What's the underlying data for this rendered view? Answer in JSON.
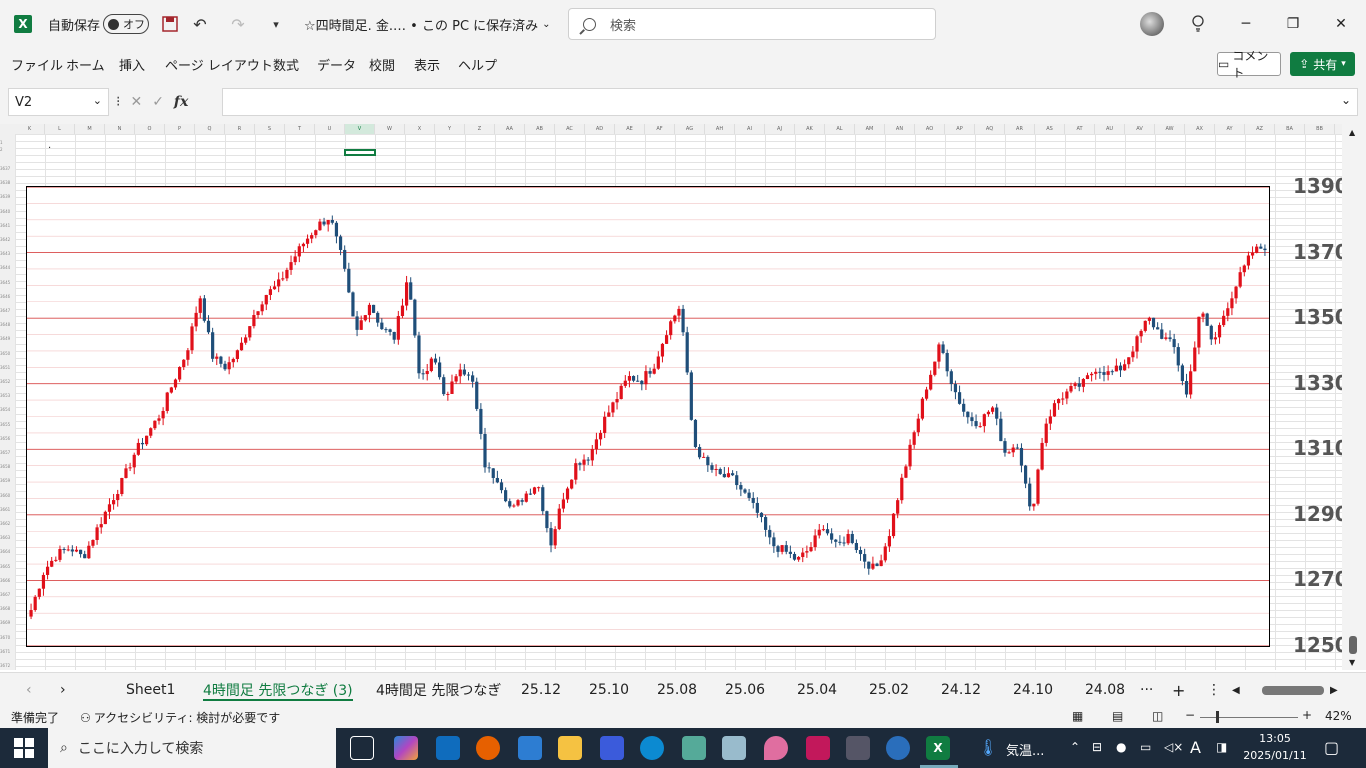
{
  "titlebar": {
    "autosave_label": "自動保存",
    "autosave_state": "オフ",
    "doc_title": "☆四時間足. 金.… • この PC に保存済み",
    "search_placeholder": "検索",
    "minimize": "─",
    "restore": "❐",
    "close": "✕"
  },
  "ribbon": {
    "tabs": [
      "ファイル",
      "ホーム",
      "挿入",
      "ページ レイアウト",
      "数式",
      "データ",
      "校閲",
      "表示",
      "ヘルプ"
    ],
    "comment_label": "コメント",
    "share_label": "共有"
  },
  "formula_bar": {
    "name_box": "V2",
    "fx": "fx",
    "formula": ""
  },
  "grid": {
    "columns": [
      "K",
      "L",
      "M",
      "N",
      "O",
      "P",
      "Q",
      "R",
      "S",
      "T",
      "U",
      "V",
      "W",
      "X",
      "Y",
      "Z",
      "AA",
      "AB",
      "AC",
      "AD",
      "AE",
      "AF",
      "AG",
      "AH",
      "AI",
      "AJ",
      "AK",
      "AL",
      "AM",
      "AN",
      "AO",
      "AP",
      "AQ",
      "AR",
      "AS",
      "AT",
      "AU",
      "AV",
      "AW",
      "AX",
      "AY",
      "AZ",
      "BA",
      "BB"
    ],
    "row_top": [
      "1",
      "2"
    ],
    "rows": [
      "3637",
      "3638",
      "3639",
      "3640",
      "3641",
      "3642",
      "3643",
      "3644",
      "3645",
      "3646",
      "3647",
      "3648",
      "3649",
      "3650",
      "3651",
      "3652",
      "3653",
      "3654",
      "3655",
      "3656",
      "3657",
      "3658",
      "3659",
      "3660",
      "3661",
      "3662",
      "3663",
      "3664",
      "3665",
      "3666",
      "3667",
      "3668",
      "3669",
      "3670",
      "3671",
      "3672",
      "3673"
    ],
    "cell_dot": "."
  },
  "chart_data": {
    "type": "candlestick",
    "y_ticks": [
      1390,
      1370,
      1350,
      1330,
      1310,
      1290,
      1270,
      1250
    ],
    "ylim": [
      1250,
      1390
    ],
    "color_up": "#e0101a",
    "color_down": "#1f4e79",
    "gridline_color": "#e07070",
    "anchor_closes": [
      1261,
      1273,
      1278,
      1280,
      1277,
      1285,
      1293,
      1300,
      1309,
      1315,
      1321,
      1331,
      1340,
      1357,
      1338,
      1335,
      1340,
      1350,
      1357,
      1360,
      1367,
      1373,
      1378,
      1381,
      1367,
      1345,
      1355,
      1347,
      1344,
      1363,
      1330,
      1338,
      1325,
      1336,
      1330,
      1304,
      1301,
      1291,
      1296,
      1300,
      1281,
      1296,
      1306,
      1308,
      1318,
      1325,
      1332,
      1331,
      1336,
      1347,
      1354,
      1312,
      1305,
      1302,
      1301,
      1296,
      1290,
      1281,
      1279,
      1276,
      1280,
      1287,
      1280,
      1284,
      1277,
      1273,
      1283,
      1300,
      1315,
      1330,
      1342,
      1329,
      1320,
      1318,
      1323,
      1309,
      1312,
      1289,
      1317,
      1325,
      1328,
      1330,
      1335,
      1333,
      1335,
      1342,
      1350,
      1345,
      1341,
      1326,
      1353,
      1342,
      1353,
      1362,
      1370,
      1372
    ]
  },
  "sheet_tabs": {
    "tabs": [
      "Sheet1",
      "4時間足 先限つなぎ (3)",
      "4時間足 先限つなぎ",
      "25.12",
      "25.10",
      "25.08",
      "25.06",
      "25.04",
      "25.02",
      "24.12",
      "24.10",
      "24.08"
    ],
    "active_index": 1,
    "more": "···",
    "add": "+"
  },
  "status": {
    "ready": "準備完了",
    "accessibility": "アクセシビリティ: 検討が必要です",
    "zoom": "42%"
  },
  "taskbar": {
    "search_placeholder": "ここに入力して検索",
    "weather": "気温...",
    "time": "13:05",
    "date": "2025/01/11"
  }
}
